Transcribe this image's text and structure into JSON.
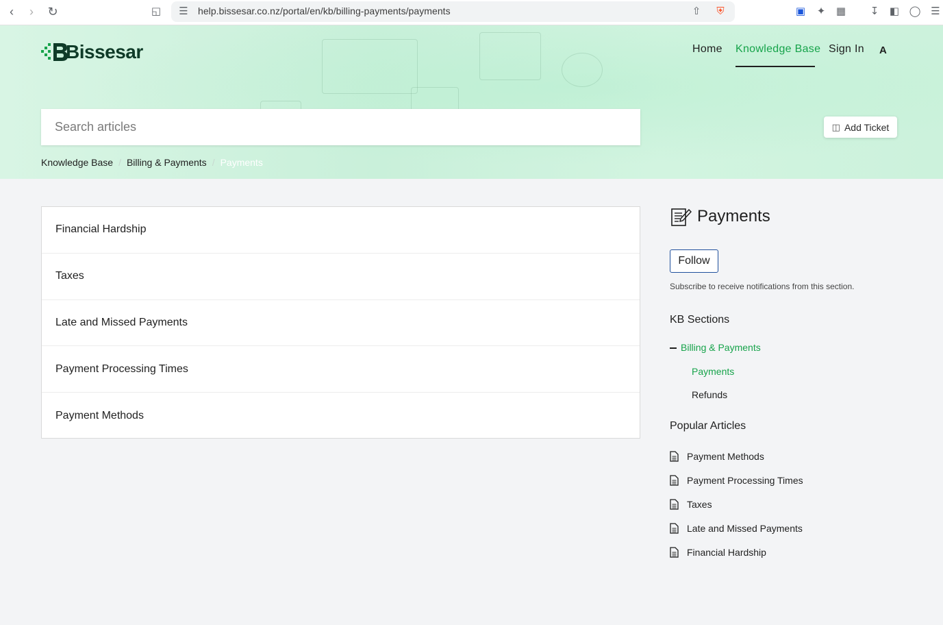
{
  "browser": {
    "url": "help.bissesar.co.nz/portal/en/kb/billing-payments/payments"
  },
  "brand": {
    "name": "Bissesar",
    "accent": "#16a34a",
    "dark": "#0f3b28"
  },
  "nav": {
    "home": "Home",
    "knowledge_base": "Knowledge Base",
    "sign_in": "Sign In",
    "a11y": "A"
  },
  "search": {
    "placeholder": "Search articles"
  },
  "add_ticket": "Add Ticket",
  "breadcrumb": {
    "items": [
      "Knowledge Base",
      "Billing & Payments"
    ],
    "current": "Payments"
  },
  "articles": [
    "Financial Hardship",
    "Taxes",
    "Late and Missed Payments",
    "Payment Processing Times",
    "Payment Methods"
  ],
  "sidebar": {
    "section_title": "Payments",
    "follow": "Follow",
    "subscribe_note": "Subscribe to receive notifications from this section.",
    "kb_sections_heading": "KB Sections",
    "kb_sections": {
      "parent": "Billing & Payments",
      "children": [
        "Payments",
        "Refunds"
      ]
    },
    "popular_heading": "Popular Articles",
    "popular": [
      "Payment Methods",
      "Payment Processing Times",
      "Taxes",
      "Late and Missed Payments",
      "Financial Hardship"
    ]
  }
}
